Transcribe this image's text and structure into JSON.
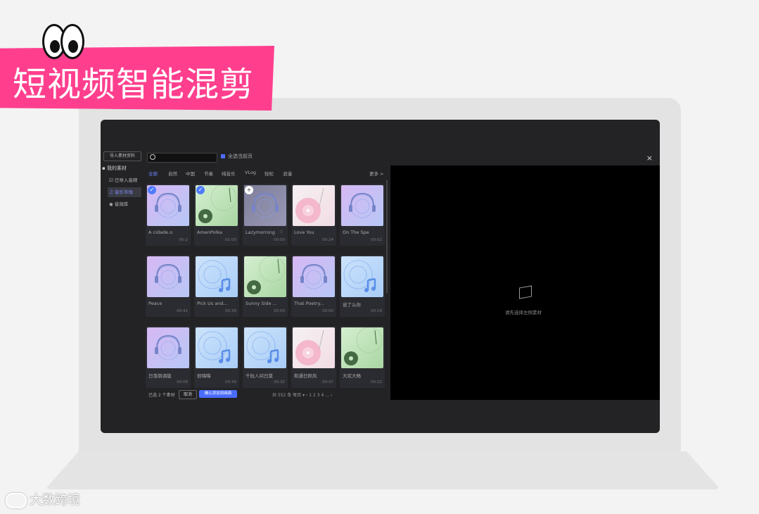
{
  "banner": {
    "title": "短视频智能混剪"
  },
  "watermark": {
    "text": "大数跨境"
  },
  "app": {
    "import_button": "导入素材资料",
    "search_placeholder": "",
    "select_all_label": "全选当前页",
    "close_label": "×",
    "sidebar": {
      "group_label": "我的素材",
      "items": [
        {
          "label": "已导入音频",
          "active": false
        },
        {
          "label": "音乐市场",
          "active": true
        },
        {
          "label": "音效库",
          "active": false
        }
      ]
    },
    "tabs": [
      {
        "label": "全部",
        "active": true
      },
      {
        "label": "自然",
        "active": false
      },
      {
        "label": "中国",
        "active": false
      },
      {
        "label": "节奏",
        "active": false
      },
      {
        "label": "纯音乐",
        "active": false
      },
      {
        "label": "VLog",
        "active": false
      },
      {
        "label": "轻松",
        "active": false
      },
      {
        "label": "浪漫",
        "active": false
      }
    ],
    "more_label": "更多 >",
    "cards": [
      {
        "title": "A cidade.o",
        "duration": "00:2",
        "style": "headphone",
        "state": "checked"
      },
      {
        "title": "AmenPolka",
        "duration": "01:00",
        "style": "vinyl-green",
        "state": "checked"
      },
      {
        "title": "Lazymorning",
        "duration": "00:00",
        "style": "headphone-dim",
        "state": "add"
      },
      {
        "title": "Love You",
        "duration": "00:24",
        "style": "vinyl-pink",
        "state": "none"
      },
      {
        "title": "On The Spe",
        "duration": "00:02",
        "style": "headphone",
        "state": "none"
      },
      {
        "title": "Peace",
        "duration": "00:42",
        "style": "headphone",
        "state": "none"
      },
      {
        "title": "Pick Us and...",
        "duration": "00:38",
        "style": "note-blue",
        "state": "none"
      },
      {
        "title": "Sunny Side ...",
        "duration": "00:00",
        "style": "vinyl-green",
        "state": "none"
      },
      {
        "title": "That Poetry...",
        "duration": "00:00",
        "style": "headphone",
        "state": "none"
      },
      {
        "title": "说了么你",
        "duration": "00:18",
        "style": "note-blue",
        "state": "none"
      },
      {
        "title": "日落倒调版",
        "duration": "00:08",
        "style": "headphone",
        "state": "none"
      },
      {
        "title": "很嗨嗨",
        "duration": "00:39",
        "style": "note-blue",
        "state": "none"
      },
      {
        "title": "千阮人间日莫",
        "duration": "00:32",
        "style": "note-blue",
        "state": "none"
      },
      {
        "title": "和通日照风",
        "duration": "00:37",
        "style": "vinyl-pink",
        "state": "none"
      },
      {
        "title": "大欢大畅",
        "duration": "00:22",
        "style": "vinyl-green",
        "state": "none"
      }
    ],
    "footer": {
      "selected_label": "已选 2 个素材",
      "cancel_label": "取消",
      "confirm_label": "确认添加到画面",
      "pagination": "共 552 条   每页 ▾   ‹  1  2  3  4  …  ›"
    },
    "preview_hint": "请先选择左侧素材"
  }
}
